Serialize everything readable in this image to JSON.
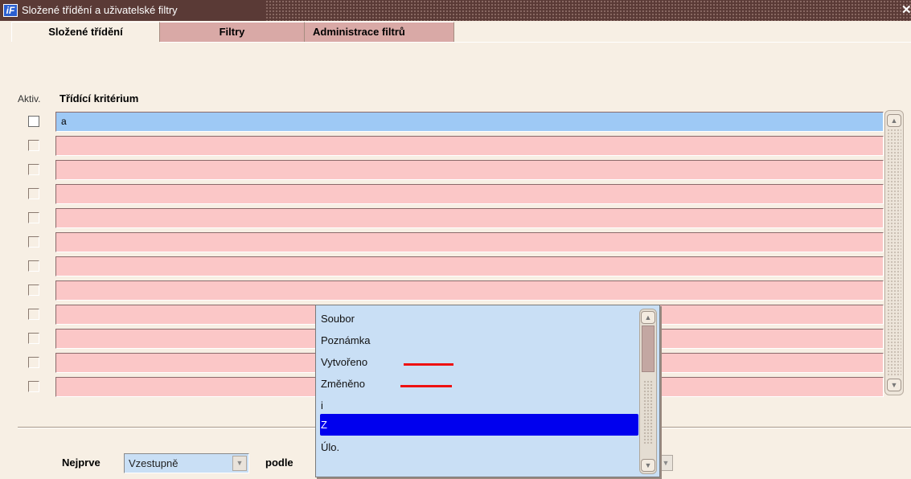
{
  "window": {
    "title": "Složené třídění a uživatelské filtry",
    "icon": "app-logo-icon",
    "icon_text": "iF",
    "close_glyph": "✕"
  },
  "tabs": [
    {
      "label": "Složené třídění",
      "active": true
    },
    {
      "label": "Filtry",
      "active": false
    },
    {
      "label": "Administrace filtrů",
      "active": false
    }
  ],
  "grid": {
    "col_active": "Aktiv.",
    "col_criterion": "Třídící kritérium",
    "rows": [
      {
        "checked": false,
        "value": "a"
      },
      {
        "checked": false,
        "value": ""
      },
      {
        "checked": false,
        "value": ""
      },
      {
        "checked": false,
        "value": ""
      },
      {
        "checked": false,
        "value": ""
      },
      {
        "checked": false,
        "value": ""
      },
      {
        "checked": false,
        "value": ""
      },
      {
        "checked": false,
        "value": ""
      },
      {
        "checked": false,
        "value": ""
      },
      {
        "checked": false,
        "value": ""
      },
      {
        "checked": false,
        "value": ""
      },
      {
        "checked": false,
        "value": ""
      }
    ]
  },
  "bottom": {
    "nejprve_label": "Nejprve",
    "order_value": "Vzestupně",
    "podle_label": "podle"
  },
  "dropdown": {
    "items": [
      {
        "label": "Soubor",
        "selected": false,
        "marked": false
      },
      {
        "label": "Poznámka",
        "selected": false,
        "marked": false
      },
      {
        "label": "Vytvořeno",
        "selected": false,
        "marked": true
      },
      {
        "label": "Změněno",
        "selected": false,
        "marked": true
      },
      {
        "label": "i",
        "selected": false,
        "marked": false
      },
      {
        "label": "Z",
        "selected": true,
        "marked": false
      },
      {
        "label": "Úlo.",
        "selected": false,
        "marked": false
      }
    ]
  },
  "colors": {
    "titlebar": "#5a3a36",
    "window_bg": "#f7efe4",
    "row_field": "#fbc7c7",
    "row_field_active": "#9ec9f5",
    "list_bg": "#c9dff5",
    "selection": "#0000ee",
    "annotation_mark": "#ee1111"
  }
}
